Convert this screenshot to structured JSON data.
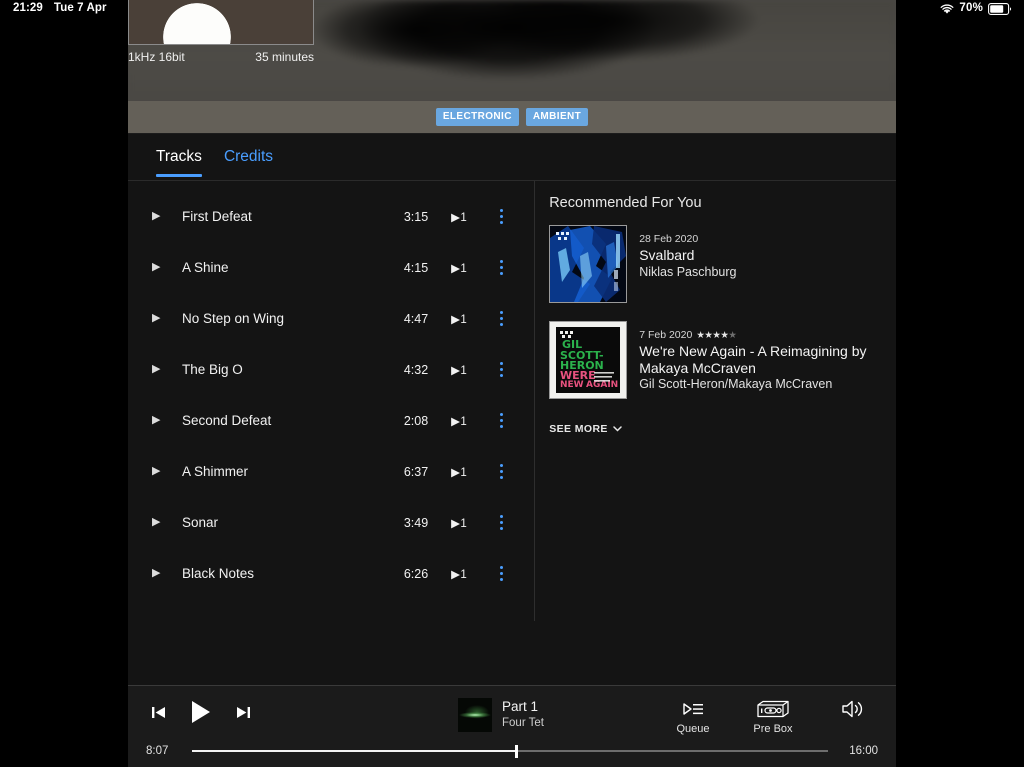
{
  "statusbar": {
    "time": "21:29",
    "date": "Tue 7 Apr",
    "battery_percent": "70%",
    "wifi_icon": "wifi-icon",
    "battery_icon": "battery-icon"
  },
  "hero": {
    "format": "1kHz 16bit",
    "duration": "35 minutes",
    "cover_icon": "album-cover-art",
    "title_obscured": ""
  },
  "tags": [
    {
      "label": "ELECTRONIC"
    },
    {
      "label": "AMBIENT"
    }
  ],
  "tabs": [
    {
      "label": "Tracks",
      "active": true
    },
    {
      "label": "Credits",
      "active": false
    }
  ],
  "tracks": {
    "items": [
      {
        "title": "First Defeat",
        "duration": "3:15",
        "plays": "1"
      },
      {
        "title": "A Shine",
        "duration": "4:15",
        "plays": "1"
      },
      {
        "title": "No Step on Wing",
        "duration": "4:47",
        "plays": "1"
      },
      {
        "title": "The Big O",
        "duration": "4:32",
        "plays": "1"
      },
      {
        "title": "Second Defeat",
        "duration": "2:08",
        "plays": "1"
      },
      {
        "title": "A Shimmer",
        "duration": "6:37",
        "plays": "1"
      },
      {
        "title": "Sonar",
        "duration": "3:49",
        "plays": "1"
      },
      {
        "title": "Black Notes",
        "duration": "6:26",
        "plays": "1"
      }
    ]
  },
  "recommended": {
    "heading": "Recommended For You",
    "items": [
      {
        "date": "28 Feb 2020",
        "stars_filled": 0,
        "title": "Svalbard",
        "artist": "Niklas Paschburg",
        "art_icon": "album-art-svalbard"
      },
      {
        "date": "7 Feb 2020",
        "stars_filled": 4,
        "title": "We're New Again - A Reimagining by Makaya McCraven",
        "artist": "Gil Scott-Heron/Makaya McCraven",
        "art_icon": "album-art-were-new-again"
      }
    ],
    "see_more": "SEE MORE"
  },
  "player": {
    "previous_icon": "skip-previous-icon",
    "play_icon": "play-icon",
    "next_icon": "skip-next-icon",
    "now_playing_title": "Part 1",
    "now_playing_artist": "Four Tet",
    "now_playing_art_icon": "now-playing-artwork",
    "queue_label": "Queue",
    "queue_icon": "queue-icon",
    "device_label": "Pre Box",
    "device_icon": "pre-box-device-icon",
    "volume_icon": "volume-icon",
    "elapsed": "8:07",
    "remaining": "16:00",
    "progress_percent": 51
  },
  "colors": {
    "accent_blue": "#4a9eff",
    "tag_blue": "#6aa7e0",
    "app_bg": "#141414",
    "tagbar_gray": "#646058",
    "player_bg": "#1b1b1b"
  }
}
